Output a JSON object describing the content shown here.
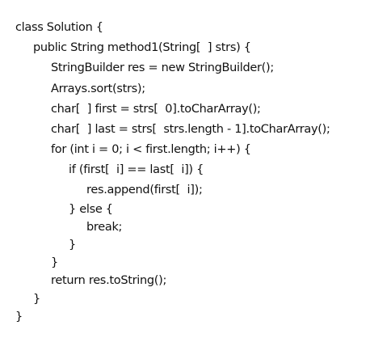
{
  "lines": [
    "class Solution {",
    "public String method1(String[  ] strs) {",
    "StringBuilder res = new StringBuilder();",
    "Arrays.sort(strs);",
    "char[  ] first = strs[  0].toCharArray();",
    "char[  ] last = strs[  strs.length - 1].toCharArray();",
    "for (int i = 0; i < first.length; i++) {",
    "if (first[  i] == last[  i]) {",
    "res.append(first[  i]);",
    "} else {",
    "break;",
    "}",
    "}",
    "return res.toString();",
    "}",
    "}"
  ]
}
